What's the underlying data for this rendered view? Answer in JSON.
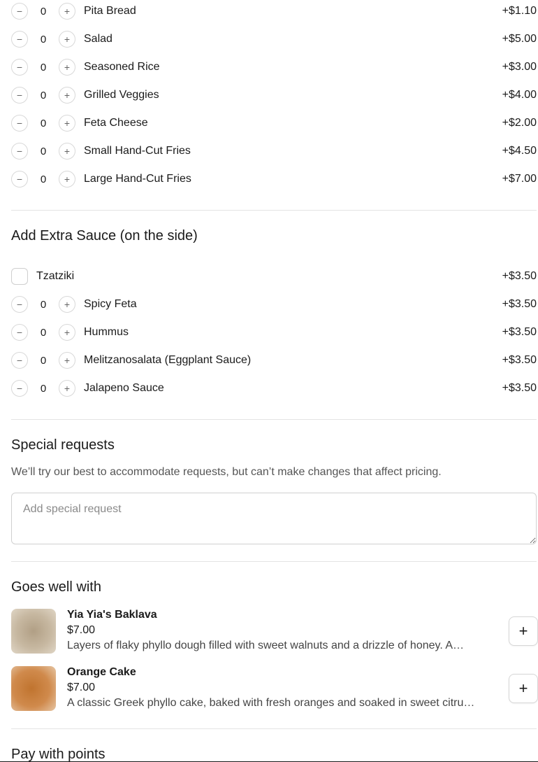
{
  "sides": [
    {
      "qty": "0",
      "label": "Pita Bread",
      "price": "+$1.10"
    },
    {
      "qty": "0",
      "label": "Salad",
      "price": "+$5.00"
    },
    {
      "qty": "0",
      "label": "Seasoned Rice",
      "price": "+$3.00"
    },
    {
      "qty": "0",
      "label": "Grilled Veggies",
      "price": "+$4.00"
    },
    {
      "qty": "0",
      "label": "Feta Cheese",
      "price": "+$2.00"
    },
    {
      "qty": "0",
      "label": "Small Hand-Cut Fries",
      "price": "+$4.50"
    },
    {
      "qty": "0",
      "label": "Large Hand-Cut Fries",
      "price": "+$7.00"
    }
  ],
  "sauce": {
    "title": "Add Extra Sauce (on the side)",
    "checkbox_item": {
      "label": "Tzatziki",
      "price": "+$3.50"
    },
    "items": [
      {
        "qty": "0",
        "label": "Spicy Feta",
        "price": "+$3.50"
      },
      {
        "qty": "0",
        "label": "Hummus",
        "price": "+$3.50"
      },
      {
        "qty": "0",
        "label": "Melitzanosalata (Eggplant Sauce)",
        "price": "+$3.50"
      },
      {
        "qty": "0",
        "label": "Jalapeno Sauce",
        "price": "+$3.50"
      }
    ]
  },
  "special": {
    "title": "Special requests",
    "note": "We’ll try our best to accommodate requests, but can’t make changes that affect pricing.",
    "placeholder": "Add special request",
    "value": ""
  },
  "goes_well": {
    "title": "Goes well with",
    "items": [
      {
        "name": "Yia Yia's Baklava",
        "price": "$7.00",
        "desc": "Layers of flaky phyllo dough filled with sweet walnuts and a drizzle of honey. A…"
      },
      {
        "name": "Orange Cake",
        "price": "$7.00",
        "desc": "A classic Greek phyllo cake, baked with fresh oranges and soaked in sweet citru…"
      }
    ]
  },
  "points": {
    "title": "Pay with points"
  },
  "icons": {
    "decrement": "minus-icon",
    "increment": "plus-icon",
    "add": "plus-icon"
  },
  "glyphs": {
    "minus": "−",
    "plus": "+"
  }
}
